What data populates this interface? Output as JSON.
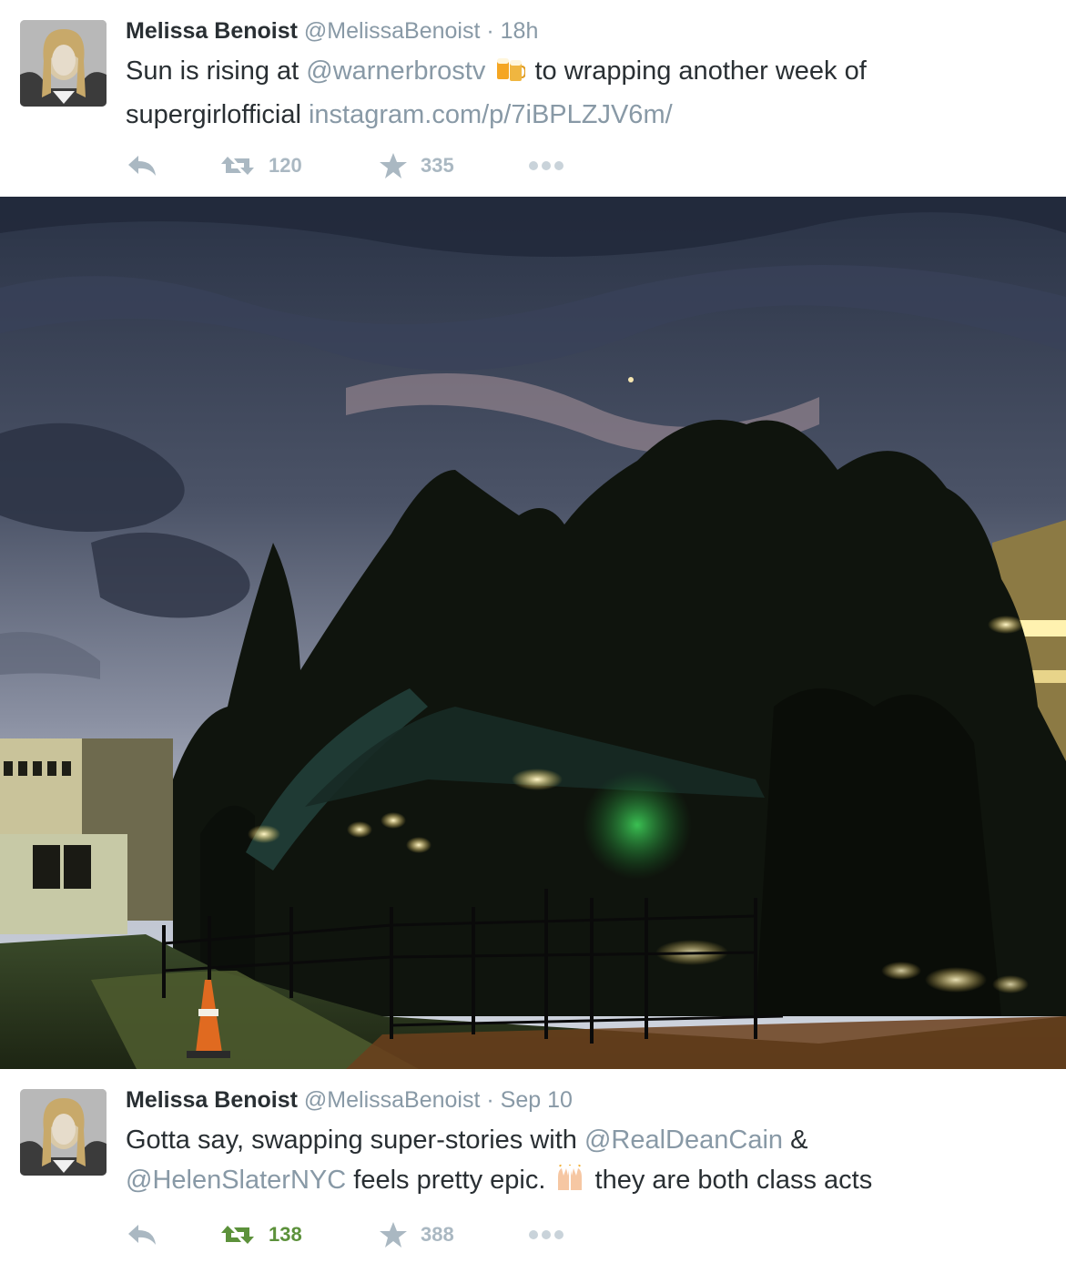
{
  "tweets": [
    {
      "name": "Melissa Benoist",
      "handle": "@MelissaBenoist",
      "separator": "·",
      "time": "18h",
      "text_1": "Sun is rising at ",
      "mention_1": "@warnerbrostv",
      "emoji_1": "beer-mugs-emoji",
      "text_2": " to wrapping another week of",
      "text_3": "supergirlofficial ",
      "link": "instagram.com/p/7iBPLZJV6m/",
      "retweets": "120",
      "favorites": "335",
      "retweeted": false
    },
    {
      "name": "Melissa Benoist",
      "handle": "@MelissaBenoist",
      "separator": "·",
      "time": "Sep 10",
      "text_1": "Gotta say, swapping super-stories with ",
      "mention_1": "@RealDeanCain",
      "text_2": " &",
      "mention_2": "@HelenSlaterNYC",
      "text_3": " feels pretty epic. ",
      "emoji_1": "raised-hands-emoji",
      "text_4": " they are both class acts",
      "retweets": "138",
      "favorites": "388",
      "retweeted": true
    }
  ],
  "colors": {
    "name": "#292f33",
    "muted": "#8899a6",
    "action": "#aab8c2",
    "retweeted": "#5c913b"
  },
  "photo": {
    "subject": "night-sky-over-studio-lot-with-trees-and-lit-walkway"
  }
}
